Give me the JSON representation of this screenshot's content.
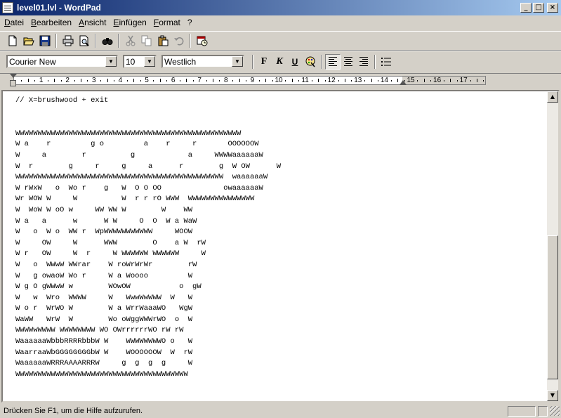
{
  "window": {
    "title": "level01.lvl - WordPad"
  },
  "caption": {
    "minimize": "_",
    "maximize": "□",
    "close": "×"
  },
  "menu": [
    "Datei",
    "Bearbeiten",
    "Ansicht",
    "Einfügen",
    "Format",
    "?"
  ],
  "toolbar": {
    "icons": [
      "new-icon",
      "open-icon",
      "save-icon",
      "print-icon",
      "print-preview-icon",
      "find-icon",
      "cut-icon",
      "copy-icon",
      "paste-icon",
      "undo-icon",
      "datetime-icon"
    ]
  },
  "format": {
    "font": "Courier New",
    "size": "10",
    "script": "Westlich",
    "bold": "F",
    "italic": "K",
    "underline": "U"
  },
  "ruler": {
    "numbers": [
      "1",
      "2",
      "3",
      "4",
      "5",
      "6",
      "7",
      "8",
      "9",
      "10",
      "11",
      "12",
      "13",
      "14",
      "15",
      "16",
      "17"
    ]
  },
  "document": {
    "lines": [
      "// X=brushwood + exit",
      "",
      "",
      "WWWWWWWWWWWWWWWWWWWWWWWWWWWWWWWWWWWWWWWWWWWWWWWWWWW",
      "W a    r         g o         a    r     r       OOOOOOW",
      "W     a        r          g            a     WWWWaaaaaaW",
      "W  r        g     r     g     a      r        g  W OW      W",
      "WWWWWWWWWWWWWWWWWWWWWWWWWWWWWWWWWWWWWWWWWWWWWWW  waaaaaaW",
      "W rWxW   o  Wo r    g   W  O O OO              owaaaaaaW",
      "Wr WOW W     W          W  r r rO WWW  WWWWWWWWWWWWWWW",
      "W  WoW W oO w     WW WW W        W    WW",
      "W a   a      w      W W     O  O  W a WaW",
      "W   o  W o  WW r  WpWWWWWWWWWWW     WOOW",
      "W     OW     W      WWW        O    a W  rW",
      "W r   OW     W  r     W WWWWWW WWWWWW     W",
      "W   o  WWwW WWrar    W roWrWrWr        rW",
      "W   g owaoW Wo r     W a Woooo         W",
      "W g O gWWwW w        WOwOW           o  gW",
      "W   w  Wro  WWWW     W   WwwWwWWW  W   W",
      "W o r  WrWO W        W a WrrWaaaWO   WgW",
      "WaWW   WrW  W        Wo oWggWWWrWO  o  W",
      "WWWWwWWWW WWWWWWWW WO OWrrrrrrWO rW rW",
      "WaaaaaaWbbbRRRRbbbW W    WWWWWWWWO o   W",
      "WaarraaWbGGGGGGGGbW W    WOOOOOOW  W  rW",
      "WaaaaaaWRRRAAAARRRW     g  g  g  g     W",
      "WWWWWWWWWWWWWWWWWWWWWWWWWWWWWWWWWWWWWWW"
    ]
  },
  "status": {
    "text": "Drücken Sie F1, um die Hilfe aufzurufen."
  }
}
